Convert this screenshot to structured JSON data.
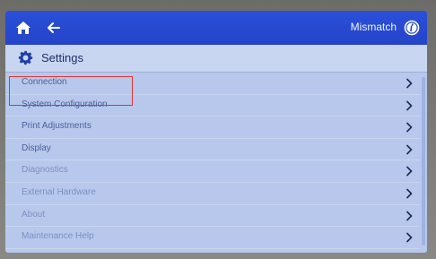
{
  "topbar": {
    "status": "Mismatch",
    "home_icon": "home-icon",
    "back_icon": "back-arrow-icon",
    "info_icon": "info-icon"
  },
  "header": {
    "title": "Settings",
    "icon": "gear-icon"
  },
  "menu": {
    "items": [
      {
        "label": "Connection"
      },
      {
        "label": "System Configuration"
      },
      {
        "label": "Print Adjustments"
      },
      {
        "label": "Display"
      },
      {
        "label": "Diagnostics"
      },
      {
        "label": "External Hardware"
      },
      {
        "label": "About"
      },
      {
        "label": "Maintenance Help"
      }
    ],
    "highlighted_item": "System Configuration"
  },
  "colors": {
    "topbar": "#2444c8",
    "background": "#b7c8ec",
    "highlight": "#e03535"
  }
}
